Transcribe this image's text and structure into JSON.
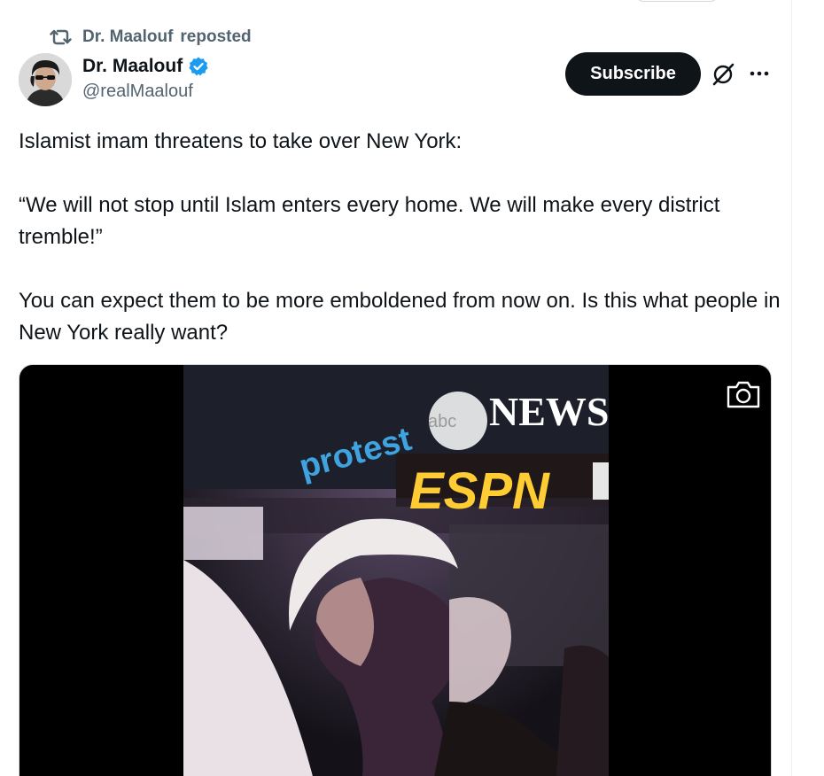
{
  "repost": {
    "icon": "repost-icon",
    "name": "Dr. Maalouf",
    "label": "reposted"
  },
  "author": {
    "display_name": "Dr. Maalouf",
    "handle": "@realMaalouf",
    "verified_icon": "verified-badge-icon",
    "avatar_icon": "avatar"
  },
  "actions": {
    "subscribe_label": "Subscribe",
    "grok_icon": "grok-icon",
    "more_icon": "more-icon"
  },
  "tweet": {
    "paragraphs": [
      "Islamist imam threatens to take over New York:",
      "“We will not stop until Islam enters every home. We will make every district tremble!”",
      "You can expect them to be more emboldened from now on. Is this what people in New York really want?"
    ]
  },
  "media": {
    "overlay_texts": [
      "protest",
      "abc",
      "NEWS",
      "ESPN"
    ],
    "camera_icon": "camera-icon",
    "colors": {
      "letterbox": "#000000",
      "news_text": "#ffffff",
      "protest_text": "#3fa3e0",
      "espn_text": "#ffcc33"
    }
  },
  "colors": {
    "text_primary": "#0f1419",
    "text_secondary": "#536471",
    "verified": "#1d9bf0",
    "button_bg": "#0f1419"
  }
}
